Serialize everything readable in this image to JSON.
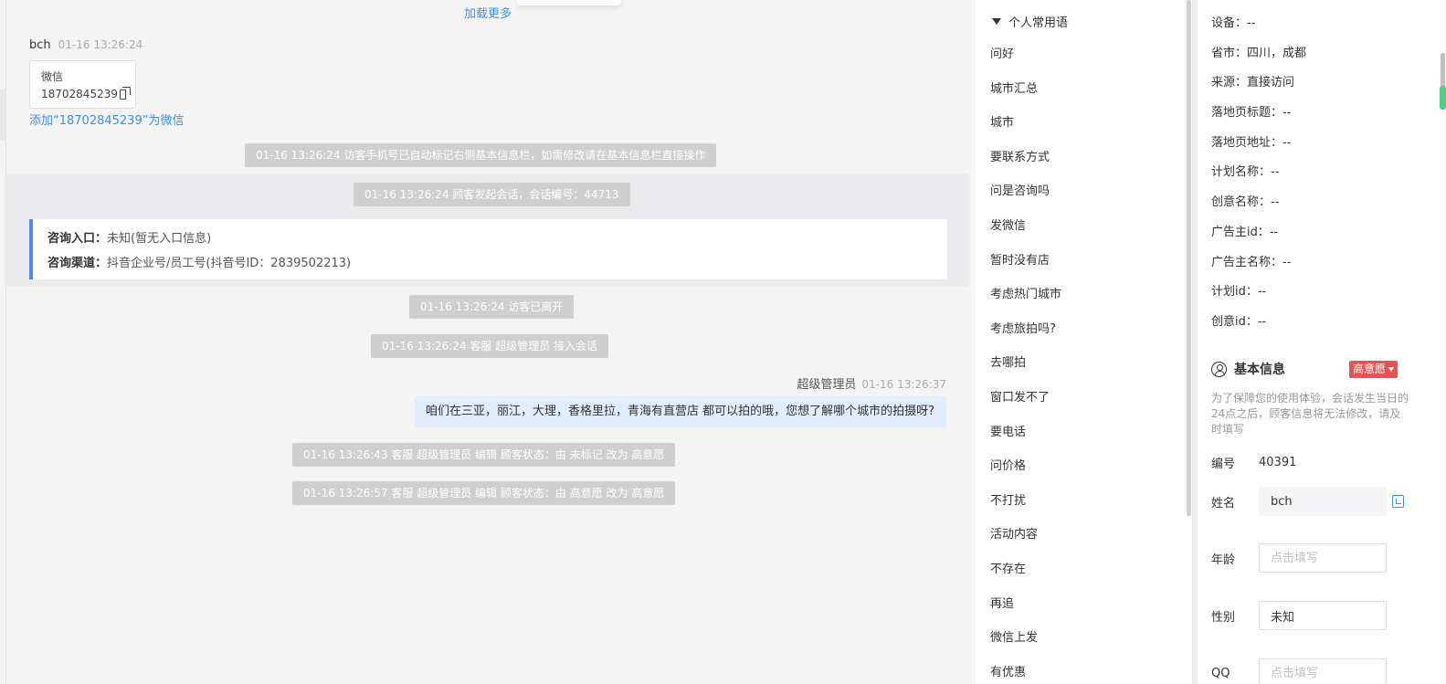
{
  "chat": {
    "load_more": "加载更多",
    "visitor": {
      "name": "bch",
      "time": "01-16 13:26:24"
    },
    "card": {
      "title": "微信",
      "number": "18702845239"
    },
    "add_wechat": "添加“18702845239”为微信",
    "system_messages": [
      "01-16 13:26:24 访客手机号已自动标记右侧基本信息栏，如需修改请在基本信息栏直接操作",
      "01-16 13:26:24 顾客发起会话，会话编号：44713",
      "01-16 13:26:24 访客已离开",
      "01-16 13:26:24 客服 超级管理员 接入会话",
      "01-16 13:26:43 客服 超级管理员 编辑 顾客状态：由 未标记 改为 高意愿",
      "01-16 13:26:57 客服 超级管理员 编辑 顾客状态：由 高意愿 改为 高意愿"
    ],
    "entry": {
      "label_1": "咨询入口：",
      "value_1": "未知(暂无入口信息)",
      "label_2": "咨询渠道：",
      "value_2": "抖音企业号/员工号(抖音号ID：2839502213)"
    },
    "agent": {
      "name": "超级管理员",
      "time": "01-16 13:26:37",
      "message": "咱们在三亚，丽江，大理，香格里拉，青海有直营店 都可以拍的哦，您想了解哪个城市的拍摄呀?"
    }
  },
  "phrases": {
    "header": "个人常用语",
    "items": [
      "问好",
      "城市汇总",
      "城市",
      "要联系方式",
      "问是咨询吗",
      "发微信",
      "暂时没有店",
      "考虑热门城市",
      "考虑旅拍吗?",
      "去哪拍",
      "窗口发不了",
      "要电话",
      "问价格",
      "不打扰",
      "活动内容",
      "不存在",
      "再追",
      "微信上发",
      "有优惠"
    ]
  },
  "info": {
    "items": [
      "设备：--",
      "省市：四川，成都",
      "来源：直接访问",
      "落地页标题：--",
      "落地页地址：--",
      "计划名称：--",
      "创意名称：--",
      "广告主id：--",
      "广告主名称：--",
      "计划id：--",
      "创意id：--"
    ],
    "basic_title": "基本信息",
    "intent_tag": "高意愿",
    "notice": "为了保障您的使用体验，会话发生当日的24点之后，顾客信息将无法修改，请及时填写",
    "fields": {
      "id_label": "编号",
      "id_value": "40391",
      "name_label": "姓名",
      "name_value": "bch",
      "age_label": "年龄",
      "age_placeholder": "点击填写",
      "gender_label": "性别",
      "gender_value": "未知",
      "qq_label": "QQ",
      "qq_placeholder": "点击填写"
    }
  }
}
